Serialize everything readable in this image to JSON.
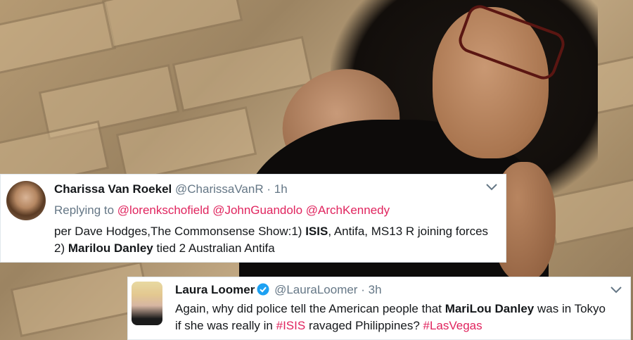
{
  "tweets": [
    {
      "display_name": "Charissa Van Roekel",
      "handle": "@CharissaVanR",
      "separator": "·",
      "time": "1h",
      "replying_prefix": "Replying to",
      "replying_to": [
        "@lorenkschofield",
        "@JohnGuandolo",
        "@ArchKennedy"
      ],
      "line1": {
        "a": "per Dave Hodges,The Commonsense Show:1) ",
        "b_bold": "ISIS",
        "c": ", Antifa, MS13 R joining forces"
      },
      "line2": {
        "a": "2) ",
        "b_bold": "Marilou Danley",
        "c": " tied 2 Australian Antifa"
      }
    },
    {
      "display_name": "Laura Loomer",
      "verified": true,
      "handle": "@LauraLoomer",
      "separator": "·",
      "time": "3h",
      "line1": {
        "a": "Again, why did police tell the American people that ",
        "b_bold": "MariLou Danley",
        "c": " was in Tokyo"
      },
      "line2": {
        "a": "if she was really in ",
        "hashtag1": "#ISIS",
        "b": " ravaged Philippines? ",
        "hashtag2": "#LasVegas"
      }
    }
  ],
  "colors": {
    "link": "#e0245e",
    "muted": "#657786",
    "text": "#14171a",
    "verified": "#1da1f2"
  },
  "icons": [
    "chevron-down-icon",
    "verified-badge-icon"
  ]
}
